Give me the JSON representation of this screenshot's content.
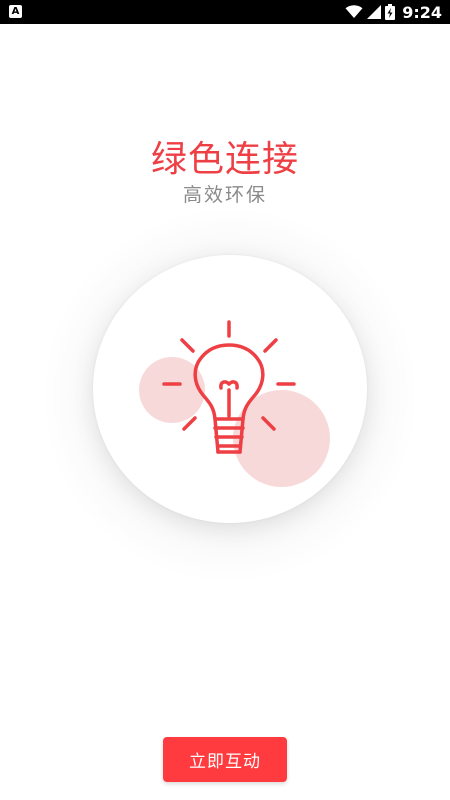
{
  "status_bar": {
    "notification_icon": "a-notification-icon",
    "wifi_icon": "wifi-icon",
    "signal_icon": "cell-signal-icon",
    "battery_icon": "battery-icon",
    "time": "9:24"
  },
  "hero": {
    "title": "绿色连接",
    "subtitle": "高效环保",
    "illustration_icon": "lightbulb-icon"
  },
  "action_button": {
    "label": "立即互动"
  },
  "colors": {
    "accent": "#ee3f45",
    "button": "#ff3b3f",
    "subtitle": "#8a8a8a"
  }
}
